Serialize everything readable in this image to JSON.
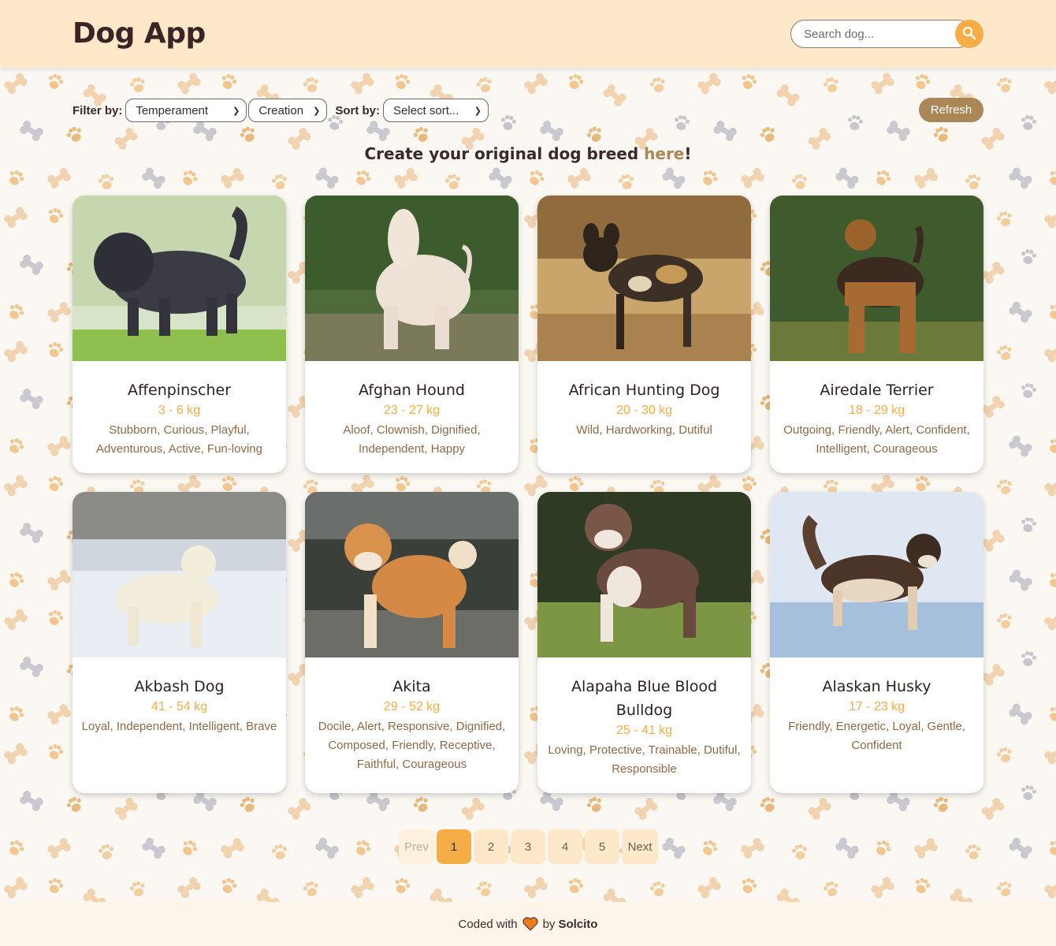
{
  "header": {
    "logo": "Dog App",
    "search_placeholder": "Search dog..."
  },
  "controls": {
    "filter_label": "Filter by:",
    "temperament_value": "Temperament",
    "creation_value": "Creation",
    "sort_label": "Sort by:",
    "sort_value": "Select sort...",
    "refresh_label": "Refresh"
  },
  "cta": {
    "prefix": "Create your original dog breed ",
    "link": "here",
    "suffix": "!"
  },
  "cards": [
    {
      "name": "Affenpinscher",
      "weight": "3 - 6 kg",
      "temperament": "Stubborn, Curious, Playful, Adventurous, Active, Fun-loving"
    },
    {
      "name": "Afghan Hound",
      "weight": "23 - 27 kg",
      "temperament": "Aloof, Clownish, Dignified, Independent, Happy"
    },
    {
      "name": "African Hunting Dog",
      "weight": "20 - 30 kg",
      "temperament": "Wild, Hardworking, Dutiful"
    },
    {
      "name": "Airedale Terrier",
      "weight": "18 - 29 kg",
      "temperament": "Outgoing, Friendly, Alert, Confident, Intelligent, Courageous"
    },
    {
      "name": "Akbash Dog",
      "weight": "41 - 54 kg",
      "temperament": "Loyal, Independent, Intelligent, Brave"
    },
    {
      "name": "Akita",
      "weight": "29 - 52 kg",
      "temperament": "Docile, Alert, Responsive, Dignified, Composed, Friendly, Receptive, Faithful, Courageous"
    },
    {
      "name": "Alapaha Blue Blood Bulldog",
      "weight": "25 - 41 kg",
      "temperament": "Loving, Protective, Trainable, Dutiful, Responsible"
    },
    {
      "name": "Alaskan Husky",
      "weight": "17 - 23 kg",
      "temperament": "Friendly, Energetic, Loyal, Gentle, Confident"
    }
  ],
  "pagination": {
    "prev": "Prev",
    "pages": [
      "1",
      "2",
      "3",
      "4",
      "5"
    ],
    "active": "1",
    "next": "Next"
  },
  "footer": {
    "prefix": "Coded with",
    "middle": "by",
    "author": "Solcito"
  },
  "colors": {
    "header_bg": "#fde9c9",
    "accent": "#f6ad45",
    "brown": "#ab8656",
    "text": "#3a2a2a"
  }
}
